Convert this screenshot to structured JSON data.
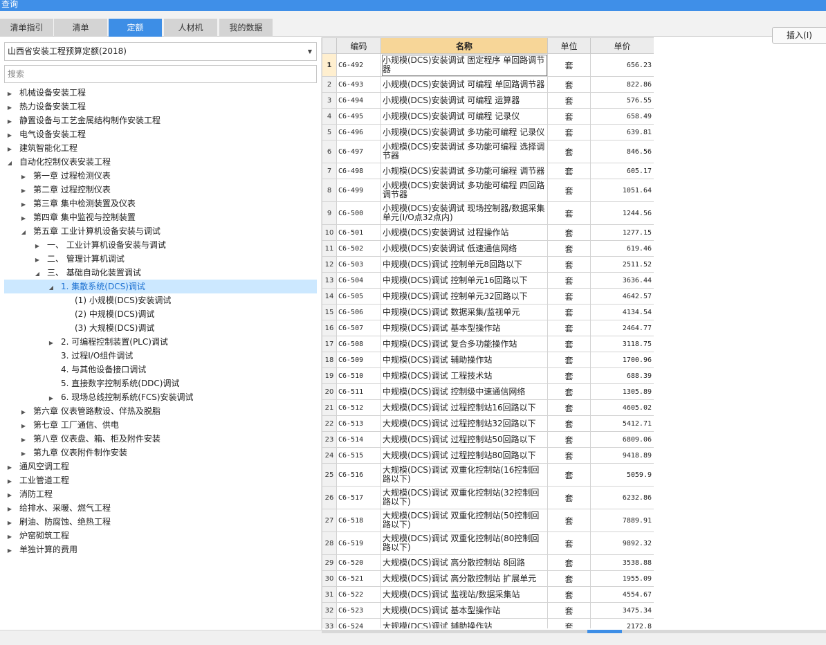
{
  "window": {
    "title": "查询"
  },
  "tabs": [
    {
      "label": "清单指引",
      "active": false
    },
    {
      "label": "清单",
      "active": false
    },
    {
      "label": "定额",
      "active": true
    },
    {
      "label": "人材机",
      "active": false
    },
    {
      "label": "我的数据",
      "active": false
    }
  ],
  "toolbar": {
    "insert_label": "插入(I)"
  },
  "library": {
    "selected": "山西省安装工程预算定额(2018)"
  },
  "search": {
    "placeholder": "搜索"
  },
  "tree": [
    {
      "label": "机械设备安装工程",
      "level": 0,
      "toggle": "collapsed"
    },
    {
      "label": "热力设备安装工程",
      "level": 0,
      "toggle": "collapsed"
    },
    {
      "label": "静置设备与工艺金属结构制作安装工程",
      "level": 0,
      "toggle": "collapsed"
    },
    {
      "label": "电气设备安装工程",
      "level": 0,
      "toggle": "collapsed"
    },
    {
      "label": "建筑智能化工程",
      "level": 0,
      "toggle": "collapsed"
    },
    {
      "label": "自动化控制仪表安装工程",
      "level": 0,
      "toggle": "expanded"
    },
    {
      "label": "第一章 过程检测仪表",
      "level": 1,
      "toggle": "collapsed"
    },
    {
      "label": "第二章 过程控制仪表",
      "level": 1,
      "toggle": "collapsed"
    },
    {
      "label": "第三章 集中检测装置及仪表",
      "level": 1,
      "toggle": "collapsed"
    },
    {
      "label": "第四章 集中监视与控制装置",
      "level": 1,
      "toggle": "collapsed"
    },
    {
      "label": "第五章 工业计算机设备安装与调试",
      "level": 1,
      "toggle": "expanded"
    },
    {
      "label": "一、 工业计算机设备安装与调试",
      "level": 2,
      "toggle": "collapsed"
    },
    {
      "label": "二、 管理计算机调试",
      "level": 2,
      "toggle": "collapsed"
    },
    {
      "label": "三、 基础自动化装置调试",
      "level": 2,
      "toggle": "expanded"
    },
    {
      "label": "1. 集散系统(DCS)调试",
      "level": 3,
      "toggle": "expanded",
      "selected": true
    },
    {
      "label": "(1) 小规模(DCS)安装调试",
      "level": 4,
      "toggle": "none"
    },
    {
      "label": "(2) 中规模(DCS)调试",
      "level": 4,
      "toggle": "none"
    },
    {
      "label": "(3) 大规模(DCS)调试",
      "level": 4,
      "toggle": "none"
    },
    {
      "label": "2. 可编程控制装置(PLC)调试",
      "level": 3,
      "toggle": "collapsed"
    },
    {
      "label": "3. 过程I/O组件调试",
      "level": 3,
      "toggle": "none"
    },
    {
      "label": "4. 与其他设备接口调试",
      "level": 3,
      "toggle": "none"
    },
    {
      "label": "5. 直接数字控制系统(DDC)调试",
      "level": 3,
      "toggle": "none"
    },
    {
      "label": "6. 现场总线控制系统(FCS)安装调试",
      "level": 3,
      "toggle": "collapsed"
    },
    {
      "label": "第六章 仪表管路敷设、伴热及脱脂",
      "level": 1,
      "toggle": "collapsed"
    },
    {
      "label": "第七章 工厂通信、供电",
      "level": 1,
      "toggle": "collapsed"
    },
    {
      "label": "第八章 仪表盘、箱、柜及附件安装",
      "level": 1,
      "toggle": "collapsed"
    },
    {
      "label": "第九章 仪表附件制作安装",
      "level": 1,
      "toggle": "collapsed"
    },
    {
      "label": "通风空调工程",
      "level": 0,
      "toggle": "collapsed"
    },
    {
      "label": "工业管道工程",
      "level": 0,
      "toggle": "collapsed"
    },
    {
      "label": "消防工程",
      "level": 0,
      "toggle": "collapsed"
    },
    {
      "label": "给排水、采暖、燃气工程",
      "level": 0,
      "toggle": "collapsed"
    },
    {
      "label": "刷油、防腐蚀、绝热工程",
      "level": 0,
      "toggle": "collapsed"
    },
    {
      "label": "炉窑砌筑工程",
      "level": 0,
      "toggle": "collapsed"
    },
    {
      "label": "单独计算的费用",
      "level": 0,
      "toggle": "collapsed"
    }
  ],
  "grid": {
    "columns": [
      "",
      "编码",
      "名称",
      "单位",
      "单价"
    ],
    "rows": [
      {
        "no": "1",
        "code": "C6-492",
        "name": "小规模(DCS)安装调试 固定程序 单回路调节器",
        "unit": "套",
        "price": "656.23"
      },
      {
        "no": "2",
        "code": "C6-493",
        "name": "小规模(DCS)安装调试 可编程 单回路调节器",
        "unit": "套",
        "price": "822.86"
      },
      {
        "no": "3",
        "code": "C6-494",
        "name": "小规模(DCS)安装调试 可编程 运算器",
        "unit": "套",
        "price": "576.55"
      },
      {
        "no": "4",
        "code": "C6-495",
        "name": "小规模(DCS)安装调试 可编程 记录仪",
        "unit": "套",
        "price": "658.49"
      },
      {
        "no": "5",
        "code": "C6-496",
        "name": "小规模(DCS)安装调试 多功能可编程 记录仪",
        "unit": "套",
        "price": "639.81"
      },
      {
        "no": "6",
        "code": "C6-497",
        "name": "小规模(DCS)安装调试 多功能可编程 选择调节器",
        "unit": "套",
        "price": "846.56"
      },
      {
        "no": "7",
        "code": "C6-498",
        "name": "小规模(DCS)安装调试 多功能可编程 调节器",
        "unit": "套",
        "price": "605.17"
      },
      {
        "no": "8",
        "code": "C6-499",
        "name": "小规模(DCS)安装调试 多功能可编程 四回路调节器",
        "unit": "套",
        "price": "1051.64"
      },
      {
        "no": "9",
        "code": "C6-500",
        "name": "小规模(DCS)安装调试 现场控制器/数据采集单元(I/O点32点内)",
        "unit": "套",
        "price": "1244.56"
      },
      {
        "no": "10",
        "code": "C6-501",
        "name": "小规模(DCS)安装调试 过程操作站",
        "unit": "套",
        "price": "1277.15"
      },
      {
        "no": "11",
        "code": "C6-502",
        "name": "小规模(DCS)安装调试 低速通信网络",
        "unit": "套",
        "price": "619.46"
      },
      {
        "no": "12",
        "code": "C6-503",
        "name": "中规模(DCS)调试 控制单元8回路以下",
        "unit": "套",
        "price": "2511.52"
      },
      {
        "no": "13",
        "code": "C6-504",
        "name": "中规模(DCS)调试 控制单元16回路以下",
        "unit": "套",
        "price": "3636.44"
      },
      {
        "no": "14",
        "code": "C6-505",
        "name": "中规模(DCS)调试 控制单元32回路以下",
        "unit": "套",
        "price": "4642.57"
      },
      {
        "no": "15",
        "code": "C6-506",
        "name": "中规模(DCS)调试 数据采集/监视单元",
        "unit": "套",
        "price": "4134.54"
      },
      {
        "no": "16",
        "code": "C6-507",
        "name": "中规模(DCS)调试 基本型操作站",
        "unit": "套",
        "price": "2464.77"
      },
      {
        "no": "17",
        "code": "C6-508",
        "name": "中规模(DCS)调试 复合多功能操作站",
        "unit": "套",
        "price": "3118.75"
      },
      {
        "no": "18",
        "code": "C6-509",
        "name": "中规模(DCS)调试 辅助操作站",
        "unit": "套",
        "price": "1700.96"
      },
      {
        "no": "19",
        "code": "C6-510",
        "name": "中规模(DCS)调试 工程技术站",
        "unit": "套",
        "price": "688.39"
      },
      {
        "no": "20",
        "code": "C6-511",
        "name": "中规模(DCS)调试 控制级中速通信网络",
        "unit": "套",
        "price": "1305.89"
      },
      {
        "no": "21",
        "code": "C6-512",
        "name": "大规模(DCS)调试 过程控制站16回路以下",
        "unit": "套",
        "price": "4605.02"
      },
      {
        "no": "22",
        "code": "C6-513",
        "name": "大规模(DCS)调试 过程控制站32回路以下",
        "unit": "套",
        "price": "5412.71"
      },
      {
        "no": "23",
        "code": "C6-514",
        "name": "大规模(DCS)调试 过程控制站50回路以下",
        "unit": "套",
        "price": "6809.06"
      },
      {
        "no": "24",
        "code": "C6-515",
        "name": "大规模(DCS)调试 过程控制站80回路以下",
        "unit": "套",
        "price": "9418.89"
      },
      {
        "no": "25",
        "code": "C6-516",
        "name": "大规模(DCS)调试 双重化控制站(16控制回路以下)",
        "unit": "套",
        "price": "5059.9"
      },
      {
        "no": "26",
        "code": "C6-517",
        "name": "大规模(DCS)调试 双重化控制站(32控制回路以下)",
        "unit": "套",
        "price": "6232.86"
      },
      {
        "no": "27",
        "code": "C6-518",
        "name": "大规模(DCS)调试 双重化控制站(50控制回路以下)",
        "unit": "套",
        "price": "7889.91"
      },
      {
        "no": "28",
        "code": "C6-519",
        "name": "大规模(DCS)调试 双重化控制站(80控制回路以下)",
        "unit": "套",
        "price": "9892.32"
      },
      {
        "no": "29",
        "code": "C6-520",
        "name": "大规模(DCS)调试 高分散控制站 8回路",
        "unit": "套",
        "price": "3538.88"
      },
      {
        "no": "30",
        "code": "C6-521",
        "name": "大规模(DCS)调试 高分散控制站 扩展单元",
        "unit": "套",
        "price": "1955.09"
      },
      {
        "no": "31",
        "code": "C6-522",
        "name": "大规模(DCS)调试 监视站/数据采集站",
        "unit": "套",
        "price": "4554.67"
      },
      {
        "no": "32",
        "code": "C6-523",
        "name": "大规模(DCS)调试 基本型操作站",
        "unit": "套",
        "price": "3475.34"
      },
      {
        "no": "33",
        "code": "C6-524",
        "name": "大规模(DCS)调试 辅助操作站",
        "unit": "套",
        "price": "2172.8"
      }
    ]
  }
}
